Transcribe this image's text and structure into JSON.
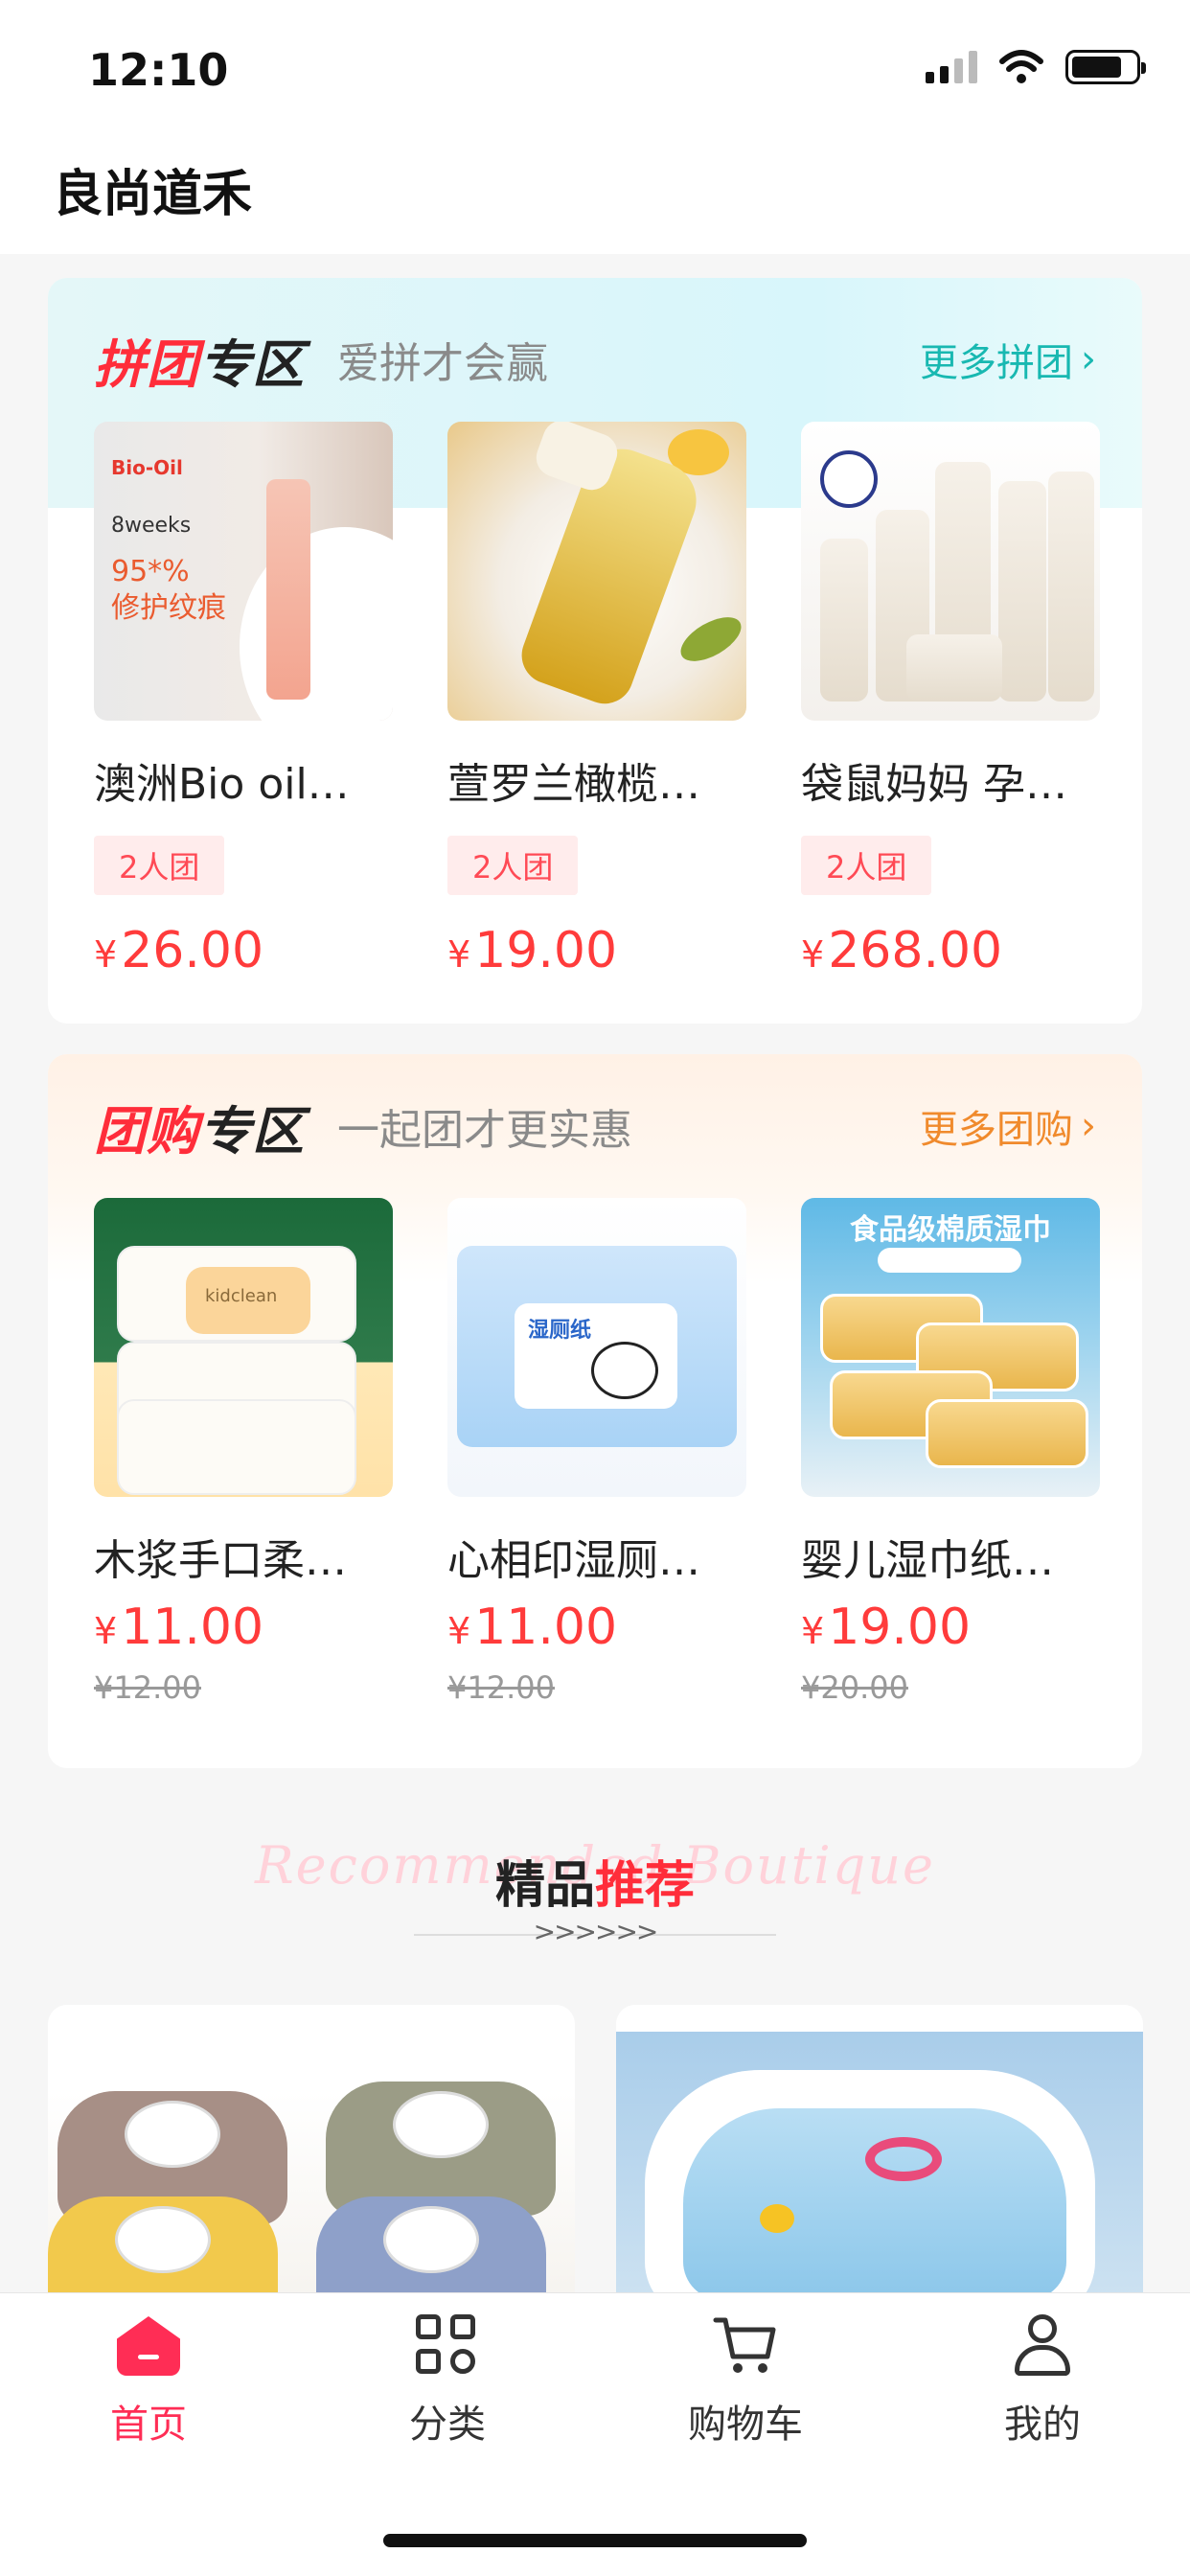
{
  "status": {
    "time": "12:10"
  },
  "header": {
    "title": "良尚道禾"
  },
  "pintuan": {
    "title_red": "拼团",
    "title_black": "专区",
    "subtitle": "爱拼才会赢",
    "more": "更多拼团",
    "products": [
      {
        "name": "澳洲Bio oil…",
        "tag": "2人团",
        "currency": "¥",
        "price": "26.00"
      },
      {
        "name": "萱罗兰橄榄…",
        "tag": "2人团",
        "currency": "¥",
        "price": "19.00"
      },
      {
        "name": "袋鼠妈妈 孕…",
        "tag": "2人团",
        "currency": "¥",
        "price": "268.00"
      }
    ]
  },
  "tuangou": {
    "title_red": "团购",
    "title_black": "专区",
    "subtitle": "一起团才更实惠",
    "more": "更多团购",
    "products": [
      {
        "name": "木浆手口柔…",
        "currency": "¥",
        "price": "11.00",
        "original": "¥12.00"
      },
      {
        "name": "心相印湿厕…",
        "currency": "¥",
        "price": "11.00",
        "original": "¥12.00"
      },
      {
        "name": "婴儿湿巾纸…",
        "currency": "¥",
        "price": "19.00",
        "original": "¥20.00"
      }
    ]
  },
  "recommend": {
    "bg_text": "Recommended Boutique",
    "title_black": "精品",
    "title_red": "推荐",
    "arrows": ">>>>>>"
  },
  "image_text": {
    "biooil_brand": "Bio-Oil",
    "biooil_weeks": "8weeks",
    "biooil_claim": "95*%\n修护纹痕",
    "kidclean_brand": "kidclean",
    "wetpaper_title": "湿厕纸",
    "wipes_banner": "食品级棉质湿巾"
  },
  "tabbar": {
    "items": [
      {
        "label": "首页",
        "icon": "home-icon",
        "active": true
      },
      {
        "label": "分类",
        "icon": "category-grid-icon",
        "active": false
      },
      {
        "label": "购物车",
        "icon": "cart-icon",
        "active": false
      },
      {
        "label": "我的",
        "icon": "profile-icon",
        "active": false
      }
    ]
  },
  "colors": {
    "accent": "#ff2d3a",
    "teal": "#18b8b1",
    "orange": "#f08a2c",
    "tab_active": "#ff2d55"
  }
}
